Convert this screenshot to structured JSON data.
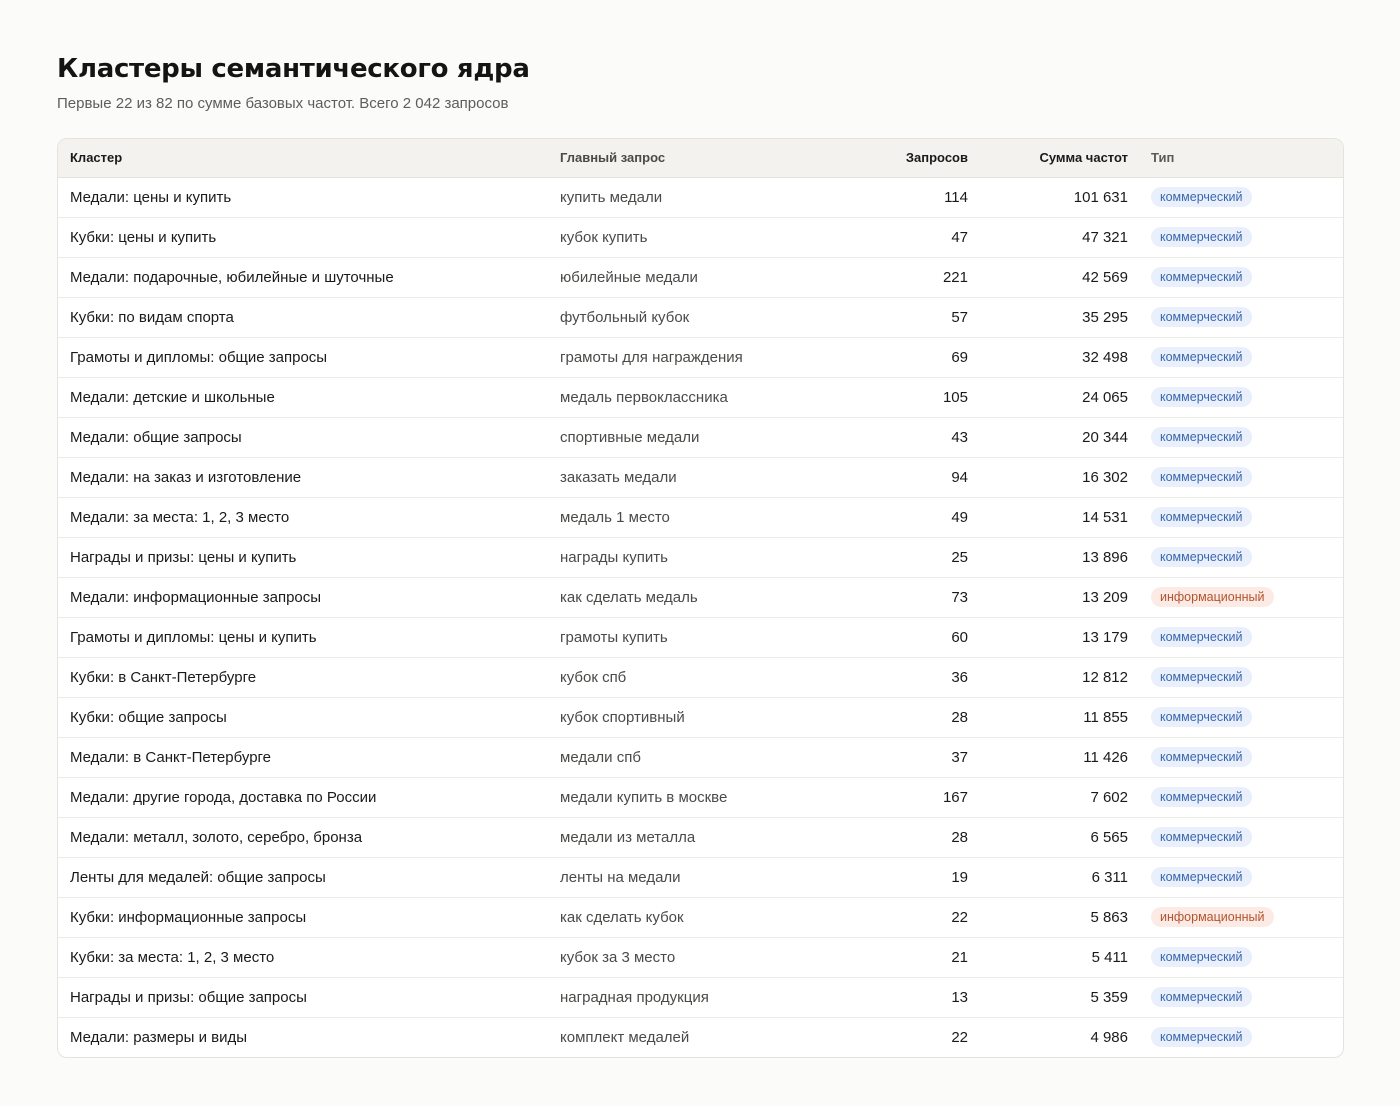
{
  "header": {
    "title": "Кластеры семантического ядра",
    "subtitle": "Первые 22 из 82 по сумме базовых частот. Всего 2 042 запросов"
  },
  "table": {
    "columns": {
      "cluster": "Кластер",
      "main_query": "Главный запрос",
      "queries": "Запросов",
      "freq_sum": "Сумма частот",
      "type": "Тип"
    },
    "type_colors": {
      "commercial": {
        "bg": "#e9f0fb",
        "fg": "#3a68b0"
      },
      "informational": {
        "bg": "#fcebe4",
        "fg": "#b5522e"
      }
    },
    "rows": [
      {
        "cluster": "Медали: цены и купить",
        "main_query": "купить медали",
        "queries": "114",
        "freq_sum": "101 631",
        "type": "коммерческий",
        "type_key": "commercial"
      },
      {
        "cluster": "Кубки: цены и купить",
        "main_query": "кубок купить",
        "queries": "47",
        "freq_sum": "47 321",
        "type": "коммерческий",
        "type_key": "commercial"
      },
      {
        "cluster": "Медали: подарочные, юбилейные и шуточные",
        "main_query": "юбилейные медали",
        "queries": "221",
        "freq_sum": "42 569",
        "type": "коммерческий",
        "type_key": "commercial"
      },
      {
        "cluster": "Кубки: по видам спорта",
        "main_query": "футбольный кубок",
        "queries": "57",
        "freq_sum": "35 295",
        "type": "коммерческий",
        "type_key": "commercial"
      },
      {
        "cluster": "Грамоты и дипломы: общие запросы",
        "main_query": "грамоты для награждения",
        "queries": "69",
        "freq_sum": "32 498",
        "type": "коммерческий",
        "type_key": "commercial"
      },
      {
        "cluster": "Медали: детские и школьные",
        "main_query": "медаль первоклассника",
        "queries": "105",
        "freq_sum": "24 065",
        "type": "коммерческий",
        "type_key": "commercial"
      },
      {
        "cluster": "Медали: общие запросы",
        "main_query": "спортивные медали",
        "queries": "43",
        "freq_sum": "20 344",
        "type": "коммерческий",
        "type_key": "commercial"
      },
      {
        "cluster": "Медали: на заказ и изготовление",
        "main_query": "заказать медали",
        "queries": "94",
        "freq_sum": "16 302",
        "type": "коммерческий",
        "type_key": "commercial"
      },
      {
        "cluster": "Медали: за места: 1, 2, 3 место",
        "main_query": "медаль 1 место",
        "queries": "49",
        "freq_sum": "14 531",
        "type": "коммерческий",
        "type_key": "commercial"
      },
      {
        "cluster": "Награды и призы: цены и купить",
        "main_query": "награды купить",
        "queries": "25",
        "freq_sum": "13 896",
        "type": "коммерческий",
        "type_key": "commercial"
      },
      {
        "cluster": "Медали: информационные запросы",
        "main_query": "как сделать медаль",
        "queries": "73",
        "freq_sum": "13 209",
        "type": "информационный",
        "type_key": "informational"
      },
      {
        "cluster": "Грамоты и дипломы: цены и купить",
        "main_query": "грамоты купить",
        "queries": "60",
        "freq_sum": "13 179",
        "type": "коммерческий",
        "type_key": "commercial"
      },
      {
        "cluster": "Кубки: в Санкт-Петербурге",
        "main_query": "кубок спб",
        "queries": "36",
        "freq_sum": "12 812",
        "type": "коммерческий",
        "type_key": "commercial"
      },
      {
        "cluster": "Кубки: общие запросы",
        "main_query": "кубок спортивный",
        "queries": "28",
        "freq_sum": "11 855",
        "type": "коммерческий",
        "type_key": "commercial"
      },
      {
        "cluster": "Медали: в Санкт-Петербурге",
        "main_query": "медали спб",
        "queries": "37",
        "freq_sum": "11 426",
        "type": "коммерческий",
        "type_key": "commercial"
      },
      {
        "cluster": "Медали: другие города, доставка по России",
        "main_query": "медали купить в москве",
        "queries": "167",
        "freq_sum": "7 602",
        "type": "коммерческий",
        "type_key": "commercial"
      },
      {
        "cluster": "Медали: металл, золото, серебро, бронза",
        "main_query": "медали из металла",
        "queries": "28",
        "freq_sum": "6 565",
        "type": "коммерческий",
        "type_key": "commercial"
      },
      {
        "cluster": "Ленты для медалей: общие запросы",
        "main_query": "ленты на медали",
        "queries": "19",
        "freq_sum": "6 311",
        "type": "коммерческий",
        "type_key": "commercial"
      },
      {
        "cluster": "Кубки: информационные запросы",
        "main_query": "как сделать кубок",
        "queries": "22",
        "freq_sum": "5 863",
        "type": "информационный",
        "type_key": "informational"
      },
      {
        "cluster": "Кубки: за места: 1, 2, 3 место",
        "main_query": "кубок за 3 место",
        "queries": "21",
        "freq_sum": "5 411",
        "type": "коммерческий",
        "type_key": "commercial"
      },
      {
        "cluster": "Награды и призы: общие запросы",
        "main_query": "наградная продукция",
        "queries": "13",
        "freq_sum": "5 359",
        "type": "коммерческий",
        "type_key": "commercial"
      },
      {
        "cluster": "Медали: размеры и виды",
        "main_query": "комплект медалей",
        "queries": "22",
        "freq_sum": "4 986",
        "type": "коммерческий",
        "type_key": "commercial"
      }
    ]
  }
}
